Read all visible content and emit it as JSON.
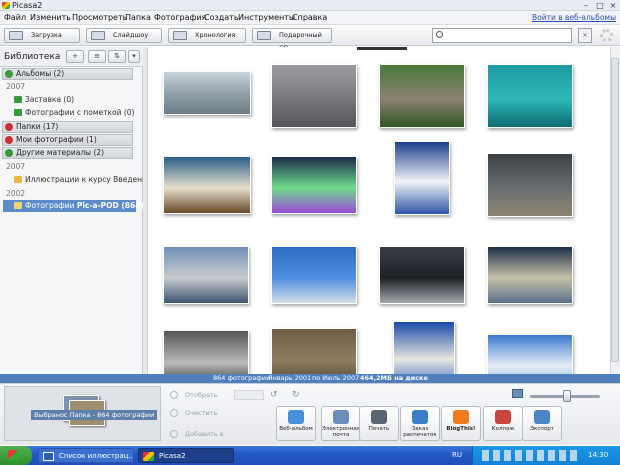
{
  "window": {
    "title": "Picasa2"
  },
  "menu": {
    "items": [
      "Файл",
      "Изменить",
      "Просмотреть",
      "Папка",
      "Фотография",
      "Создать",
      "Инструменты",
      "Справка"
    ],
    "weblink": "Войти в веб-альбомы"
  },
  "toolbar": {
    "import_label": "Загрузка",
    "slideshow_label": "Слайдшоу",
    "timeline_label": "Хронология",
    "giftcd_label": "Подарочный CD",
    "search_value": ""
  },
  "library": {
    "title": "Библиотека",
    "sections": [
      {
        "label": "Альбомы (2)",
        "state": "expanded",
        "color": "#3a9a3a"
      },
      {
        "label": "Папки (17)",
        "state": "collapsed",
        "color": "#c83232"
      },
      {
        "label": "Мои фотографии (1)",
        "state": "collapsed",
        "color": "#c83232"
      },
      {
        "label": "Другие материалы (2)",
        "state": "expanded",
        "color": "#3a9a3a"
      }
    ],
    "years": [
      "2007",
      "2007",
      "2002"
    ],
    "albums": [
      "Заставка (0)",
      "Фотографии с пометкой (0)"
    ],
    "folders": [
      {
        "label": "Иллюстрации к курсу Введение...",
        "selected": false
      },
      {
        "label_prefix": "Фотографии ",
        "label_bold": "Pic-a-POD (864)",
        "selected": true
      }
    ]
  },
  "status": {
    "count": "864 фотографии",
    "from": "Январь 2001",
    "to": "по Июль 2007",
    "size": "464,2МБ на диске"
  },
  "tray": {
    "held_label": "Выбранос Папка - 864 фотографии",
    "hold_label": "Отобрать",
    "clear_label": "Очистить",
    "add_label": "Добавить в"
  },
  "actions": [
    {
      "label": "Веб-альбом",
      "color": "#4a90d9",
      "icon": "web-album-icon"
    },
    {
      "label": "Электронная почта",
      "color": "#6b8fb8",
      "icon": "email-icon"
    },
    {
      "label": "Печать",
      "color": "#5b6673",
      "icon": "print-icon"
    },
    {
      "label": "Заказ распечаток",
      "color": "#3a7fc8",
      "icon": "order-prints-icon"
    },
    {
      "label": "BlogThis!",
      "color": "#f07a1e",
      "icon": "blogger-icon"
    },
    {
      "label": "Коллаж",
      "color": "#c9463d",
      "icon": "collage-icon"
    },
    {
      "label": "Экспорт",
      "color": "#4d86c4",
      "icon": "export-icon"
    }
  ],
  "taskbar": {
    "start_label": "",
    "tasks": [
      "Список иллюстрац...",
      "Picasa2"
    ],
    "lang": "RU",
    "clock": "14:30"
  },
  "photos": [
    {
      "desc": "misty-sea",
      "colors": [
        "#c9d3da",
        "#8e9ca6",
        "#6d7c86"
      ]
    },
    {
      "desc": "grey-sky-sea",
      "colors": [
        "#9a9ca0",
        "#76787c",
        "#55575b"
      ]
    },
    {
      "desc": "stone-sphere",
      "colors": [
        "#4a7a3a",
        "#8c8270",
        "#2f5525"
      ]
    },
    {
      "desc": "sea-dragon",
      "colors": [
        "#1e9aa0",
        "#2db8b6",
        "#0e6c74"
      ]
    },
    {
      "desc": "wave",
      "colors": [
        "#2a5d86",
        "#e6dfcc",
        "#6b4a2a"
      ]
    },
    {
      "desc": "aurora",
      "colors": [
        "#1b2a4a",
        "#6fdc8c",
        "#9b4bd6"
      ]
    },
    {
      "desc": "matterhorn",
      "colors": [
        "#1c3f8a",
        "#f2f4f8",
        "#2c55a6"
      ]
    },
    {
      "desc": "storm",
      "colors": [
        "#3a3f44",
        "#6a6f72",
        "#8c8470"
      ]
    },
    {
      "desc": "fighter-jet",
      "colors": [
        "#6f8fb6",
        "#c9cbcf",
        "#3d5570"
      ]
    },
    {
      "desc": "bomber-jet",
      "colors": [
        "#2f6cc2",
        "#4e8ee0",
        "#d6dde8"
      ]
    },
    {
      "desc": "glider",
      "colors": [
        "#3a3e44",
        "#1c1f24",
        "#a3a8ae"
      ]
    },
    {
      "desc": "sunset-sky",
      "colors": [
        "#1e2f4a",
        "#c6c1a8",
        "#5b6f8a"
      ]
    },
    {
      "desc": "rocks-bw",
      "colors": [
        "#555",
        "#bbb",
        "#222"
      ]
    },
    {
      "desc": "rock",
      "colors": [
        "#6d5e46",
        "#8f7d60",
        "#4a3f2e"
      ]
    },
    {
      "desc": "obelisk",
      "colors": [
        "#1a4aa8",
        "#e8e6e0",
        "#2f64c4"
      ]
    },
    {
      "desc": "clouds",
      "colors": [
        "#3a7ad0",
        "#e9eef6",
        "#6aa0e0"
      ]
    }
  ]
}
